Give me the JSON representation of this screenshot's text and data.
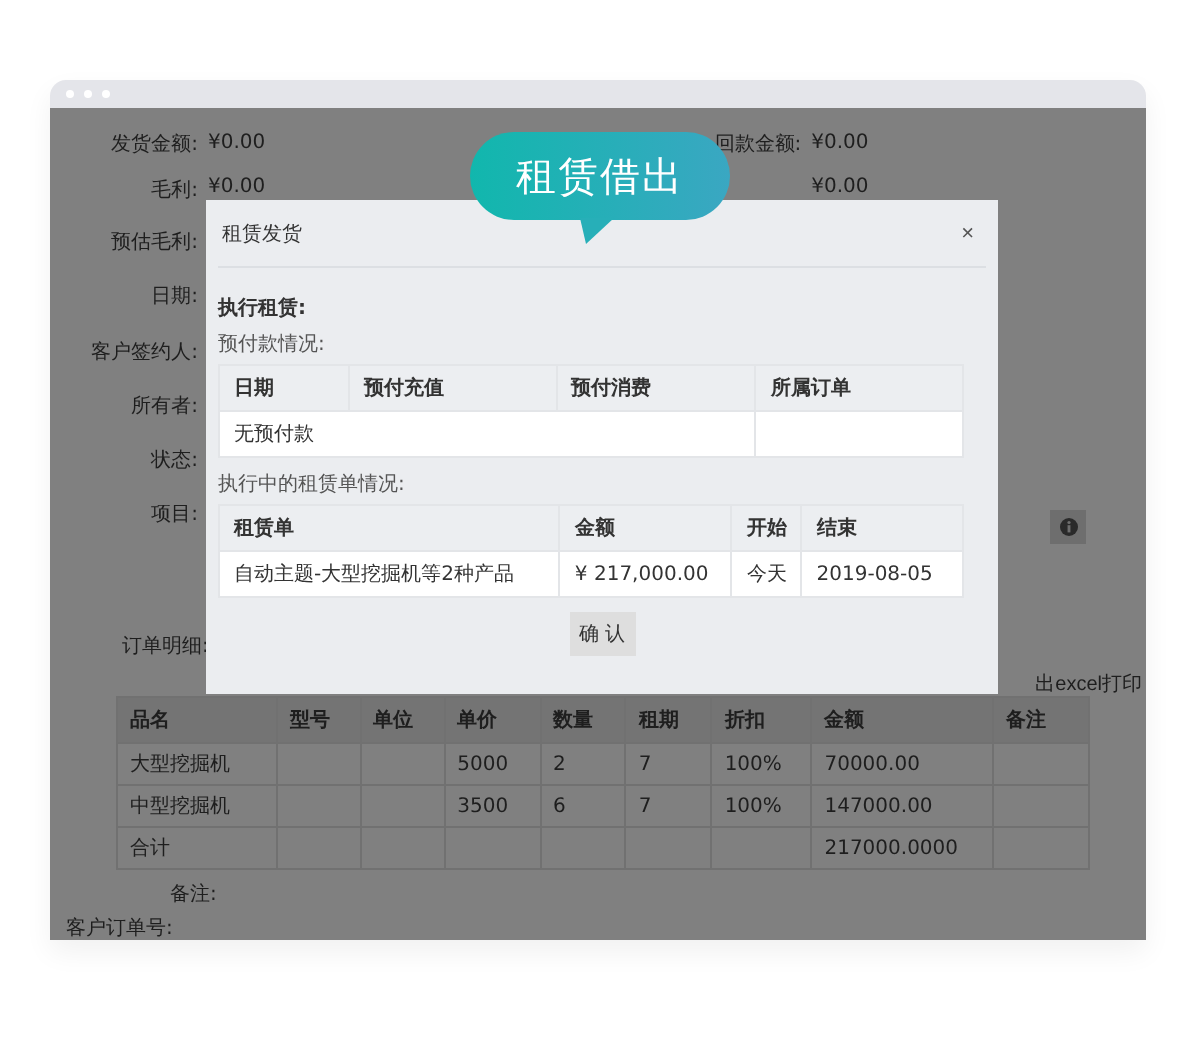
{
  "page": {
    "fields_left": [
      {
        "label": "发货金额:",
        "value": "¥0.00"
      },
      {
        "label": "毛利:",
        "value": "¥0.00"
      },
      {
        "label": "预估毛利:"
      },
      {
        "label": "日期:"
      },
      {
        "label": "客户签约人:"
      },
      {
        "label": "所有者:"
      },
      {
        "label": "状态:"
      },
      {
        "label": "项目:"
      }
    ],
    "fields_right": [
      {
        "label": "回款金额:",
        "value": "¥0.00"
      },
      {
        "value": "¥0.00"
      }
    ],
    "order_details_label": "订单明细:",
    "export_link": "出excel打印",
    "table": {
      "columns": [
        "品名",
        "型号",
        "单位",
        "单价",
        "数量",
        "租期",
        "折扣",
        "金额",
        "备注"
      ],
      "rows": [
        [
          "大型挖掘机",
          "",
          "",
          "5000",
          "2",
          "7",
          "100%",
          "70000.00",
          ""
        ],
        [
          "中型挖掘机",
          "",
          "",
          "3500",
          "6",
          "7",
          "100%",
          "147000.00",
          ""
        ],
        [
          "合计",
          "",
          "",
          "",
          "",
          "",
          "",
          "217000.0000",
          ""
        ]
      ]
    },
    "remarks_label": "备注:",
    "customer_order_label": "客户订单号:"
  },
  "bubble": {
    "text": "租赁借出"
  },
  "modal": {
    "title": "租赁发货",
    "close": "×",
    "heading": "执行租赁:",
    "prepay_label": "预付款情况:",
    "prepay_table": {
      "columns": [
        "日期",
        "预付充值",
        "预付消费",
        "所属订单"
      ],
      "empty_note": "无预付款"
    },
    "lease_label": "执行中的租赁单情况:",
    "lease_table": {
      "columns": [
        "租赁单",
        "金额",
        "开始",
        "结束"
      ],
      "rows": [
        [
          "自动主题-大型挖掘机等2种产品",
          "¥ 217,000.00",
          "今天",
          "2019-08-05"
        ]
      ]
    },
    "confirm": "确 认"
  }
}
